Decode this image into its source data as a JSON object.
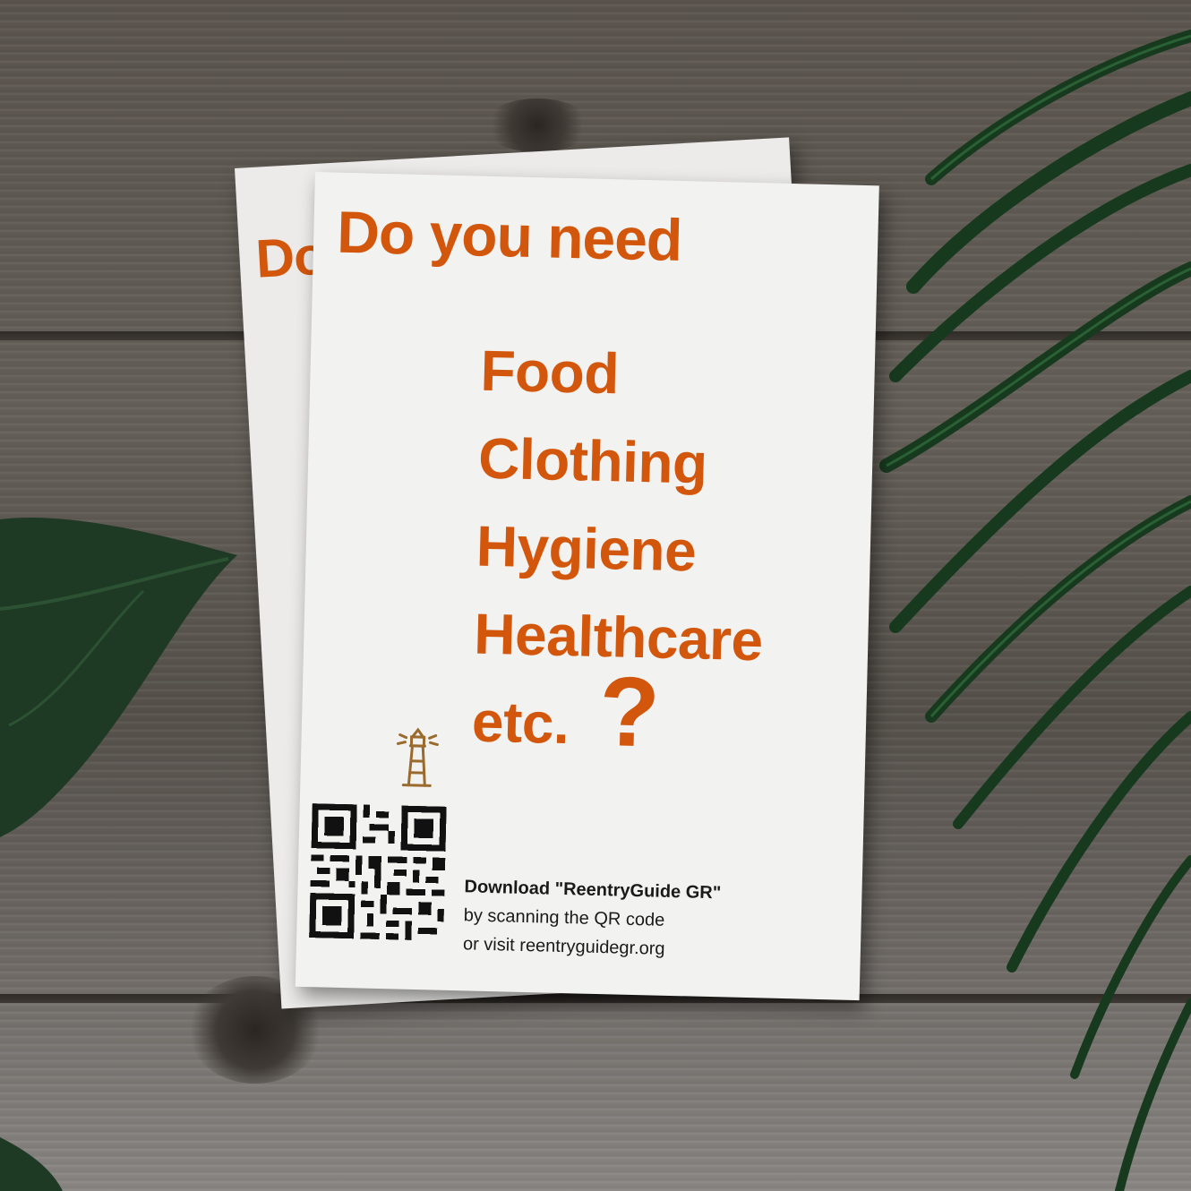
{
  "flyer": {
    "back_title_fragment": "Do",
    "title": "Do you need",
    "items": [
      "Food",
      "Clothing",
      "Hygiene",
      "Healthcare",
      "etc."
    ],
    "question_mark": "?",
    "cta_line1": "Download \"ReentryGuide GR\"",
    "cta_line2": "by scanning the QR code",
    "cta_line3": "or visit reentryguidegr.org",
    "icon": "lighthouse-icon"
  },
  "colors": {
    "accent": "#d2560c",
    "icon": "#9a6a2e",
    "paper": "#f2f2f0",
    "text": "#1a1a1a"
  }
}
